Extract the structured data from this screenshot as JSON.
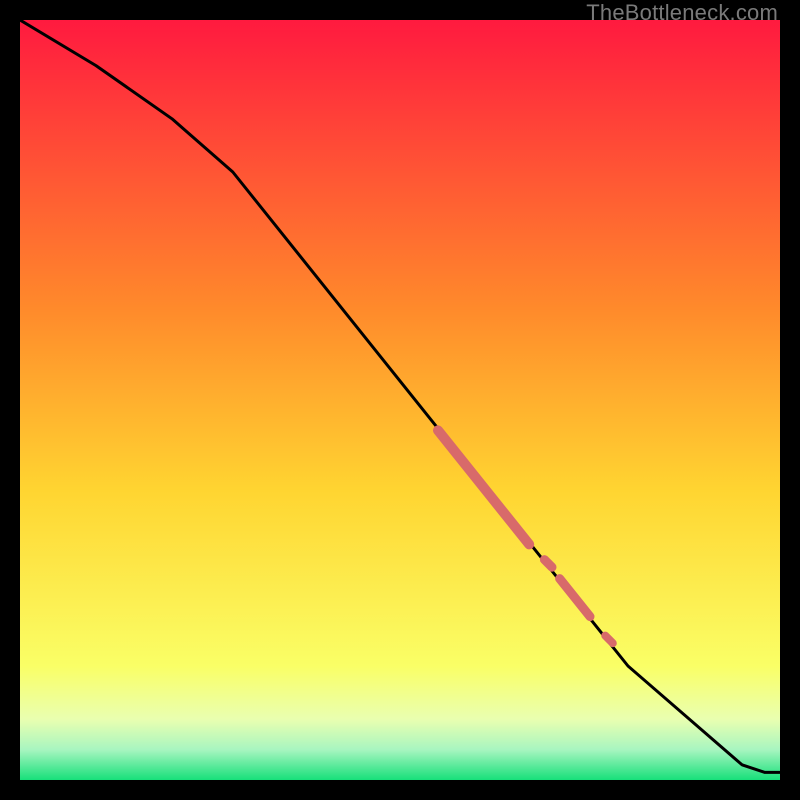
{
  "watermark": "TheBottleneck.com",
  "colors": {
    "background": "#000000",
    "gradient_top": "#ff1a3f",
    "gradient_mid_upper": "#ff8a2b",
    "gradient_mid": "#ffd531",
    "gradient_low1": "#faff66",
    "gradient_low2": "#e9ffb0",
    "gradient_low3": "#a8f5c0",
    "gradient_bottom": "#17e07a",
    "line": "#000000",
    "marker": "#d86a6a"
  },
  "chart_data": {
    "type": "line",
    "title": "",
    "xlabel": "",
    "ylabel": "",
    "xlim": [
      0,
      100
    ],
    "ylim": [
      0,
      100
    ],
    "series": [
      {
        "name": "bottleneck-curve",
        "x": [
          0,
          10,
          20,
          28,
          60,
          72,
          80,
          95,
          98,
          100
        ],
        "y": [
          100,
          94,
          87,
          80,
          40,
          25,
          15,
          2,
          1,
          1
        ]
      }
    ],
    "markers": [
      {
        "name": "thick-segment-1",
        "x0": 55,
        "y0": 46,
        "x1": 67,
        "y1": 31,
        "width": 10
      },
      {
        "name": "dot-1",
        "x0": 69,
        "y0": 29,
        "x1": 70,
        "y1": 28,
        "width": 9
      },
      {
        "name": "thick-segment-2",
        "x0": 71,
        "y0": 26.5,
        "x1": 75,
        "y1": 21.5,
        "width": 9
      },
      {
        "name": "dot-2",
        "x0": 77,
        "y0": 19,
        "x1": 78,
        "y1": 18,
        "width": 8
      }
    ]
  }
}
